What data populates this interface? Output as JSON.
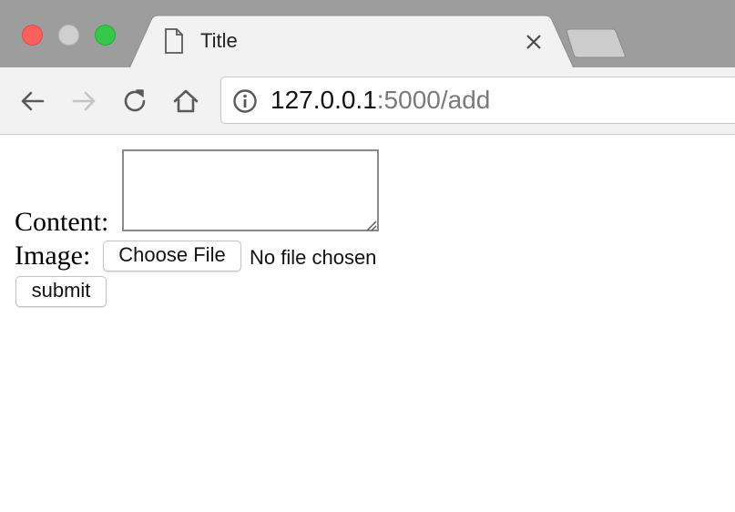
{
  "browser": {
    "tab": {
      "title": "Title",
      "icon": "page-icon",
      "close_icon": "close-icon"
    },
    "new_tab_icon": "new-tab-icon",
    "window_controls": [
      "close",
      "minimize",
      "maximize"
    ],
    "navigation": {
      "back_icon": "back-arrow-icon",
      "forward_icon": "forward-arrow-icon",
      "reload_icon": "reload-icon",
      "home_icon": "home-icon"
    },
    "address_bar": {
      "host": "127.0.0.1",
      "rest": ":5000/add",
      "icon": "info-icon"
    }
  },
  "form": {
    "content_label": "Content:",
    "content_value": "",
    "image_label": "Image:",
    "choose_file_label": "Choose File",
    "file_status": "No file chosen",
    "submit_label": "submit"
  },
  "colors": {
    "tabstrip_bg": "#9d9d9d",
    "active_tab_bg": "#f2f2f2",
    "close_light": "#fc605c",
    "minimize_light": "#cfcfcf",
    "maximize_light": "#34c84a",
    "url_host": "#111111",
    "url_rest": "#7a7a7a"
  }
}
